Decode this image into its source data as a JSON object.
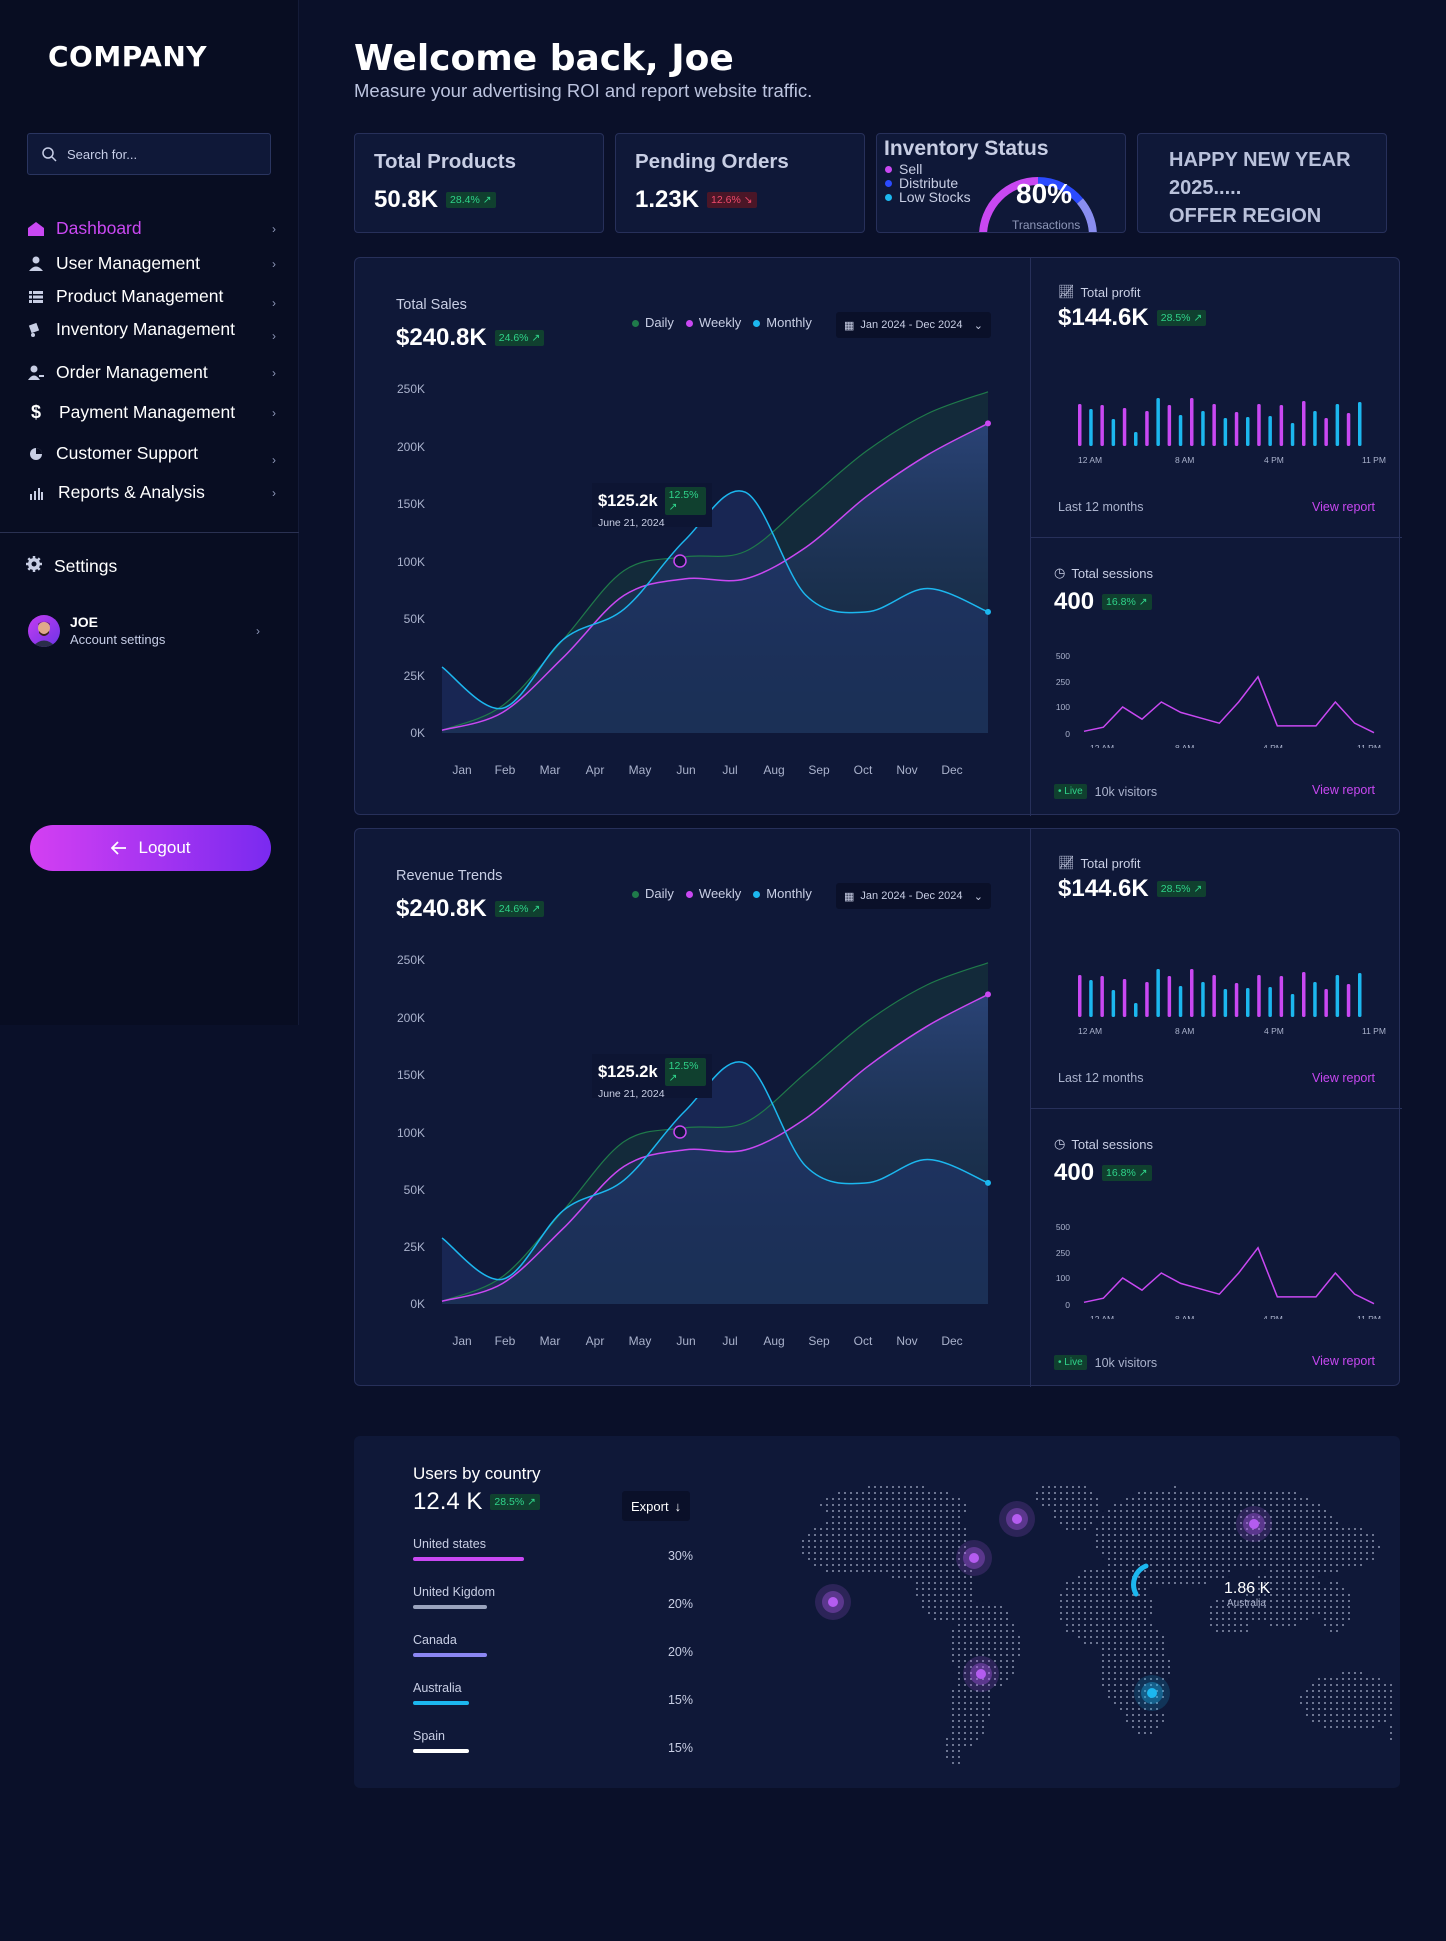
{
  "brand": {
    "logo": "COMPANY"
  },
  "search": {
    "placeholder": "Search for..."
  },
  "sidebar": {
    "items": [
      {
        "label": "Dashboard",
        "icon": "home-icon",
        "active": true
      },
      {
        "label": "User Management",
        "icon": "user-icon"
      },
      {
        "label": "Product Management",
        "icon": "list-icon"
      },
      {
        "label": "Inventory Management",
        "icon": "truck-icon"
      },
      {
        "label": "Order Management",
        "icon": "user-edit-icon"
      },
      {
        "label": "Payment Management",
        "icon": "dollar-icon"
      },
      {
        "label": "Customer Support",
        "icon": "support-icon"
      },
      {
        "label": "Reports & Analysis",
        "icon": "bar-chart-icon"
      }
    ],
    "settings": "Settings",
    "account": {
      "name": "JOE",
      "sub": "Account settings"
    },
    "logout": "Logout"
  },
  "header": {
    "title": "Welcome back, Joe",
    "subtitle": "Measure your advertising ROI and report website traffic."
  },
  "kpis": {
    "products": {
      "title": "Total Products",
      "value": "50.8K",
      "change": "28.4%"
    },
    "orders": {
      "title": "Pending Orders",
      "value": "1.23K",
      "change": "12.6%"
    },
    "inventory": {
      "title": "Inventory Status",
      "legend": [
        "Sell",
        "Distribute",
        "Low Stocks"
      ],
      "value": "80%",
      "sub": "Transactions",
      "fraction": 0.8
    },
    "offer": {
      "line1": "HAPPY NEW YEAR",
      "line2": "2025.....",
      "line3": "OFFER REGION"
    }
  },
  "panels": [
    {
      "title": "Total Sales",
      "value": "$240.8K",
      "change": "24.6%",
      "legend": [
        "Daily",
        "Weekly",
        "Monthly"
      ],
      "date_range": "Jan 2024 - Dec 2024",
      "tooltip": {
        "value": "$125.2k",
        "change": "12.5%",
        "date": "June 21, 2024"
      },
      "profit": {
        "title": "Total profit",
        "value": "$144.6K",
        "change": "28.5%",
        "footer": "Last 12 months",
        "link": "View report"
      },
      "sessions": {
        "title": "Total sessions",
        "value": "400",
        "change": "16.8%",
        "live": "Live",
        "visitors": "10k visitors",
        "link": "View report"
      }
    },
    {
      "title": "Revenue Trends",
      "value": "$240.8K",
      "change": "24.6%",
      "legend": [
        "Daily",
        "Weekly",
        "Monthly"
      ],
      "date_range": "Jan 2024 - Dec 2024",
      "tooltip": {
        "value": "$125.2k",
        "change": "12.5%",
        "date": "June 21, 2024"
      },
      "profit": {
        "title": "Total profit",
        "value": "$144.6K",
        "change": "28.5%",
        "footer": "Last 12 months",
        "link": "View report"
      },
      "sessions": {
        "title": "Total sessions",
        "value": "400",
        "change": "16.8%",
        "live": "Live",
        "visitors": "10k visitors",
        "link": "View report"
      }
    }
  ],
  "chart_data": [
    {
      "type": "area",
      "categories": [
        "Jan",
        "Feb",
        "Mar",
        "Apr",
        "May",
        "Jun",
        "Jul",
        "Aug",
        "Sep",
        "Oct",
        "Nov",
        "Dec"
      ],
      "yticks": [
        "0K",
        "25K",
        "50K",
        "100K",
        "150K",
        "200K",
        "250K"
      ],
      "ylim": [
        0,
        250
      ],
      "series": [
        {
          "name": "Daily",
          "color": "#1f7a4a",
          "values": [
            2,
            20,
            68,
            118,
            128,
            132,
            168,
            205,
            232,
            248
          ]
        },
        {
          "name": "Weekly",
          "color": "#c948f2",
          "values": [
            2,
            15,
            55,
            100,
            112,
            112,
            135,
            172,
            202,
            225
          ]
        },
        {
          "name": "Monthly",
          "color": "#1cb7ef",
          "values": [
            48,
            18,
            68,
            90,
            140,
            175,
            100,
            88,
            105,
            88
          ]
        }
      ]
    },
    {
      "type": "bar",
      "xticks": [
        "12 AM",
        "8 AM",
        "4 PM",
        "11 PM"
      ],
      "series": [
        {
          "name": "Total profit",
          "values": [
            42,
            37,
            41,
            27,
            38,
            14,
            35,
            48,
            41,
            31,
            48,
            35,
            42,
            28,
            34,
            29,
            42,
            30,
            41,
            23,
            45,
            35,
            28,
            42,
            33,
            44
          ]
        }
      ]
    },
    {
      "type": "line",
      "xticks": [
        "12 AM",
        "8 AM",
        "4 PM",
        "11 PM"
      ],
      "yticks": [
        "500",
        "250",
        "100",
        "0"
      ],
      "series": [
        {
          "name": "Total sessions",
          "values": [
            10,
            25,
            100,
            55,
            130,
            80,
            60,
            40,
            130,
            300,
            30,
            30,
            30,
            130,
            40,
            5
          ]
        }
      ]
    }
  ],
  "countries": {
    "title": "Users by country",
    "value": "12.4 K",
    "change": "28.5%",
    "export": "Export",
    "rows": [
      {
        "name": "United states",
        "pct": "30%",
        "fraction": 0.3,
        "color": "#c948f2"
      },
      {
        "name": "United Kigdom",
        "pct": "20%",
        "fraction": 0.2,
        "color": "#9aa3bd"
      },
      {
        "name": "Canada",
        "pct": "20%",
        "fraction": 0.2,
        "color": "#8b86f2"
      },
      {
        "name": "Australia",
        "pct": "15%",
        "fraction": 0.15,
        "color": "#1cb7ef"
      },
      {
        "name": "Spain",
        "pct": "15%",
        "fraction": 0.15,
        "color": "#ffffff"
      }
    ],
    "map_label": {
      "value": "1.86 K",
      "sub": "Australia"
    }
  },
  "colors": {
    "accent": "#c948f2",
    "green": "#2fd38a",
    "red": "#f04a6c",
    "blue": "#1cb7ef"
  }
}
